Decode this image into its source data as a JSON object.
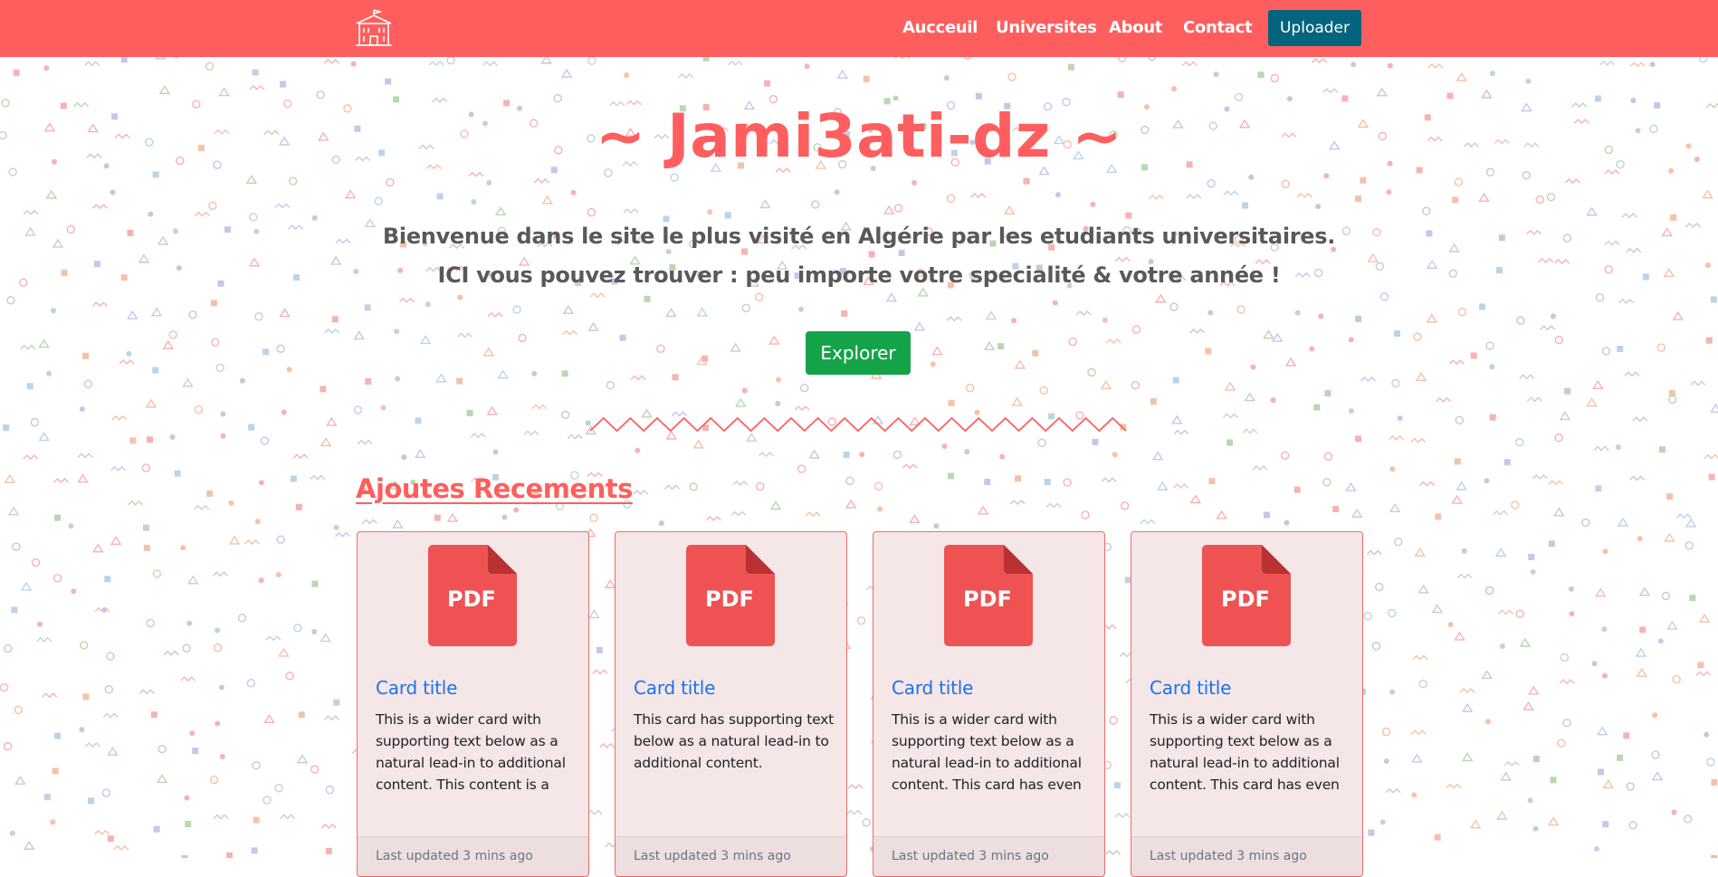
{
  "navbar": {
    "links": [
      "Aucceuil",
      "Universites",
      "About",
      "Contact"
    ],
    "upload_label": "Uploader"
  },
  "hero": {
    "title": "~ Jami3ati-dz ~",
    "line1": "Bienvenue dans le site le plus visité en Algérie par les etudiants universitaires.",
    "line2": "ICI vous pouvez trouver : peu importe votre specialité & votre année !",
    "explore_label": "Explorer"
  },
  "section": {
    "title": "Ajoutes Recements"
  },
  "cards": [
    {
      "icon_label": "PDF",
      "title": "Card title",
      "text": "This is a wider card with supporting text below as a natural lead-in to additional content. This content is a",
      "footer": "Last updated 3 mins ago"
    },
    {
      "icon_label": "PDF",
      "title": "Card title",
      "text": "This card has supporting text below as a natural lead-in to additional content.",
      "footer": "Last updated 3 mins ago"
    },
    {
      "icon_label": "PDF",
      "title": "Card title",
      "text": "This is a wider card with supporting text below as a natural lead-in to additional content. This card has even",
      "footer": "Last updated 3 mins ago"
    },
    {
      "icon_label": "PDF",
      "title": "Card title",
      "text": "This is a wider card with supporting text below as a natural lead-in to additional content. This card has even",
      "footer": "Last updated 3 mins ago"
    }
  ],
  "colors": {
    "primary": "#ff5e5e",
    "upload_button": "#04647e",
    "explore_button": "#15a34a",
    "card_title": "#1a73e8",
    "card_bg": "#f5e6e8"
  },
  "icons": [
    "university-building-icon",
    "pdf-file-icon"
  ]
}
